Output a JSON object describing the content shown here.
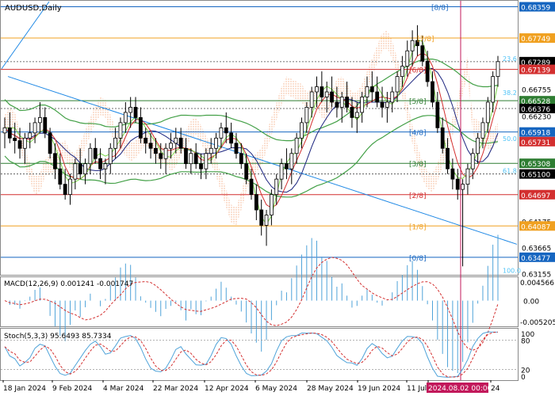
{
  "header": {
    "symbol_label": "AUDUSD,Daily"
  },
  "chart_data": [
    {
      "type": "candlestick",
      "title": "AUDUSD,Daily",
      "ylim": [
        0.6315,
        0.6846
      ],
      "price_ticks": [
        "0.68359",
        "0.67749",
        "0.67289",
        "0.67139",
        "0.66755",
        "0.66528",
        "0.66376",
        "0.66230",
        "0.65918",
        "0.65731",
        "0.65308",
        "0.65100",
        "0.64697",
        "0.64175",
        "0.64087",
        "0.63665",
        "0.63477",
        "0.63155"
      ],
      "highlighted_ticks": [
        {
          "label": "0.68359",
          "color": "#1565c0"
        },
        {
          "label": "0.67749",
          "color": "#f0a020"
        },
        {
          "label": "0.67289",
          "color": "#000000"
        },
        {
          "label": "0.67139",
          "color": "#d32f2f"
        },
        {
          "label": "0.66528",
          "color": "#2e7d32"
        },
        {
          "label": "0.66376",
          "color": "#000000"
        },
        {
          "label": "0.65918",
          "color": "#1565c0"
        },
        {
          "label": "0.65731",
          "color": "#d32f2f"
        },
        {
          "label": "0.65308",
          "color": "#2e7d32"
        },
        {
          "label": "0.65100",
          "color": "#000000"
        },
        {
          "label": "0.64697",
          "color": "#d32f2f"
        },
        {
          "label": "0.64087",
          "color": "#f0a020"
        },
        {
          "label": "0.63477",
          "color": "#1565c0"
        }
      ],
      "murrey_levels": [
        {
          "label": "[8/8]",
          "value": 0.68359,
          "color": "#1565c0"
        },
        {
          "label": "[7/8]",
          "value": 0.67749,
          "color": "#f0a020"
        },
        {
          "label": "[6/8]",
          "value": 0.67139,
          "color": "#d32f2f"
        },
        {
          "label": "[5/8]",
          "value": 0.66528,
          "color": "#2e7d32"
        },
        {
          "label": "[4/8]",
          "value": 0.65918,
          "color": "#1565c0"
        },
        {
          "label": "[3/8]",
          "value": 0.65308,
          "color": "#2e7d32"
        },
        {
          "label": "[2/8]",
          "value": 0.64697,
          "color": "#d32f2f"
        },
        {
          "label": "[1/8]",
          "value": 0.64087,
          "color": "#f0a020"
        },
        {
          "label": "[0/8]",
          "value": 0.63477,
          "color": "#1565c0"
        }
      ],
      "fibo_levels": [
        {
          "label": "23.6",
          "value": 0.67289
        },
        {
          "label": "38.2",
          "value": 0.6662
        },
        {
          "label": "50.0",
          "value": 0.65731
        },
        {
          "label": "61.8",
          "value": 0.651
        },
        {
          "label": "100.0",
          "value": 0.63155
        }
      ],
      "x_tick_labels": [
        "18 Jan 2024",
        "9 Feb 2024",
        "4 Mar 2024",
        "22 Mar 2024",
        "12 Apr 2024",
        "6 May 2024",
        "28 May 2024",
        "19 Jun 2024",
        "11 Jul",
        "2024.08.02 00:00",
        "24"
      ],
      "crosshair": {
        "date_label": "2024.08.02 00:00"
      },
      "candles": [
        [
          0.659,
          0.662,
          0.656,
          0.66
        ],
        [
          0.66,
          0.663,
          0.657,
          0.658
        ],
        [
          0.658,
          0.661,
          0.655,
          0.6575
        ],
        [
          0.6575,
          0.66,
          0.654,
          0.656
        ],
        [
          0.656,
          0.659,
          0.653,
          0.658
        ],
        [
          0.658,
          0.661,
          0.656,
          0.659
        ],
        [
          0.659,
          0.662,
          0.657,
          0.661
        ],
        [
          0.661,
          0.665,
          0.659,
          0.662
        ],
        [
          0.662,
          0.664,
          0.658,
          0.659
        ],
        [
          0.659,
          0.66,
          0.654,
          0.655
        ],
        [
          0.655,
          0.657,
          0.65,
          0.652
        ],
        [
          0.652,
          0.655,
          0.648,
          0.649
        ],
        [
          0.649,
          0.652,
          0.646,
          0.647
        ],
        [
          0.647,
          0.651,
          0.645,
          0.65
        ],
        [
          0.65,
          0.654,
          0.648,
          0.653
        ],
        [
          0.653,
          0.656,
          0.65,
          0.651
        ],
        [
          0.651,
          0.654,
          0.649,
          0.653
        ],
        [
          0.653,
          0.657,
          0.651,
          0.656
        ],
        [
          0.656,
          0.658,
          0.653,
          0.654
        ],
        [
          0.654,
          0.656,
          0.65,
          0.652
        ],
        [
          0.652,
          0.654,
          0.649,
          0.653
        ],
        [
          0.653,
          0.657,
          0.651,
          0.656
        ],
        [
          0.656,
          0.66,
          0.654,
          0.658
        ],
        [
          0.658,
          0.662,
          0.656,
          0.661
        ],
        [
          0.661,
          0.665,
          0.659,
          0.663
        ],
        [
          0.663,
          0.666,
          0.66,
          0.664
        ],
        [
          0.664,
          0.666,
          0.661,
          0.662
        ],
        [
          0.662,
          0.664,
          0.657,
          0.658
        ],
        [
          0.658,
          0.66,
          0.655,
          0.657
        ],
        [
          0.657,
          0.659,
          0.654,
          0.656
        ],
        [
          0.656,
          0.658,
          0.653,
          0.655
        ],
        [
          0.655,
          0.657,
          0.652,
          0.654
        ],
        [
          0.654,
          0.657,
          0.651,
          0.656
        ],
        [
          0.656,
          0.659,
          0.654,
          0.657
        ],
        [
          0.657,
          0.66,
          0.655,
          0.658
        ],
        [
          0.658,
          0.66,
          0.655,
          0.656
        ],
        [
          0.656,
          0.658,
          0.652,
          0.653
        ],
        [
          0.653,
          0.656,
          0.651,
          0.655
        ],
        [
          0.655,
          0.657,
          0.652,
          0.653
        ],
        [
          0.653,
          0.655,
          0.65,
          0.652
        ],
        [
          0.652,
          0.656,
          0.65,
          0.655
        ],
        [
          0.655,
          0.658,
          0.653,
          0.656
        ],
        [
          0.656,
          0.659,
          0.654,
          0.658
        ],
        [
          0.658,
          0.661,
          0.656,
          0.66
        ],
        [
          0.66,
          0.663,
          0.657,
          0.659
        ],
        [
          0.659,
          0.661,
          0.656,
          0.657
        ],
        [
          0.657,
          0.659,
          0.654,
          0.655
        ],
        [
          0.655,
          0.657,
          0.652,
          0.653
        ],
        [
          0.653,
          0.655,
          0.649,
          0.65
        ],
        [
          0.65,
          0.652,
          0.646,
          0.647
        ],
        [
          0.647,
          0.649,
          0.642,
          0.644
        ],
        [
          0.644,
          0.646,
          0.639,
          0.641
        ],
        [
          0.641,
          0.644,
          0.637,
          0.643
        ],
        [
          0.643,
          0.648,
          0.641,
          0.647
        ],
        [
          0.647,
          0.651,
          0.645,
          0.65
        ],
        [
          0.65,
          0.654,
          0.648,
          0.653
        ],
        [
          0.653,
          0.656,
          0.65,
          0.652
        ],
        [
          0.652,
          0.656,
          0.649,
          0.655
        ],
        [
          0.655,
          0.659,
          0.653,
          0.658
        ],
        [
          0.658,
          0.662,
          0.656,
          0.661
        ],
        [
          0.661,
          0.665,
          0.659,
          0.664
        ],
        [
          0.664,
          0.668,
          0.662,
          0.667
        ],
        [
          0.667,
          0.67,
          0.664,
          0.668
        ],
        [
          0.668,
          0.671,
          0.665,
          0.666
        ],
        [
          0.666,
          0.669,
          0.663,
          0.667
        ],
        [
          0.667,
          0.67,
          0.664,
          0.665
        ],
        [
          0.665,
          0.668,
          0.662,
          0.664
        ],
        [
          0.664,
          0.667,
          0.661,
          0.666
        ],
        [
          0.666,
          0.669,
          0.663,
          0.664
        ],
        [
          0.664,
          0.666,
          0.66,
          0.662
        ],
        [
          0.662,
          0.665,
          0.659,
          0.663
        ],
        [
          0.663,
          0.667,
          0.661,
          0.666
        ],
        [
          0.666,
          0.67,
          0.664,
          0.668
        ],
        [
          0.668,
          0.671,
          0.665,
          0.667
        ],
        [
          0.667,
          0.67,
          0.664,
          0.665
        ],
        [
          0.665,
          0.668,
          0.662,
          0.664
        ],
        [
          0.664,
          0.667,
          0.661,
          0.665
        ],
        [
          0.665,
          0.668,
          0.663,
          0.667
        ],
        [
          0.667,
          0.671,
          0.665,
          0.67
        ],
        [
          0.67,
          0.674,
          0.668,
          0.672
        ],
        [
          0.672,
          0.677,
          0.67,
          0.675
        ],
        [
          0.675,
          0.679,
          0.672,
          0.677
        ],
        [
          0.677,
          0.68,
          0.674,
          0.676
        ],
        [
          0.676,
          0.678,
          0.672,
          0.673
        ],
        [
          0.673,
          0.675,
          0.668,
          0.669
        ],
        [
          0.669,
          0.671,
          0.664,
          0.665
        ],
        [
          0.665,
          0.667,
          0.659,
          0.66
        ],
        [
          0.66,
          0.662,
          0.655,
          0.656
        ],
        [
          0.656,
          0.658,
          0.651,
          0.652
        ],
        [
          0.652,
          0.654,
          0.648,
          0.65
        ],
        [
          0.65,
          0.652,
          0.646,
          0.648
        ],
        [
          0.648,
          0.65,
          0.633,
          0.649
        ],
        [
          0.649,
          0.653,
          0.647,
          0.652
        ],
        [
          0.652,
          0.656,
          0.65,
          0.655
        ],
        [
          0.655,
          0.659,
          0.653,
          0.658
        ],
        [
          0.658,
          0.662,
          0.656,
          0.661
        ],
        [
          0.661,
          0.666,
          0.659,
          0.665
        ],
        [
          0.665,
          0.671,
          0.663,
          0.67
        ],
        [
          0.67,
          0.674,
          0.668,
          0.6729
        ]
      ],
      "macd": {
        "label": "MACD(12,26,9) 0.001241 -0.001747",
        "ticks": [
          "0.004566",
          "0.00",
          "-0.005205"
        ]
      },
      "stochastic": {
        "label": "Stoch(5,3,3) 95.6493 85.7334",
        "ticks": [
          "100",
          "80",
          "20",
          "0"
        ]
      }
    }
  ]
}
